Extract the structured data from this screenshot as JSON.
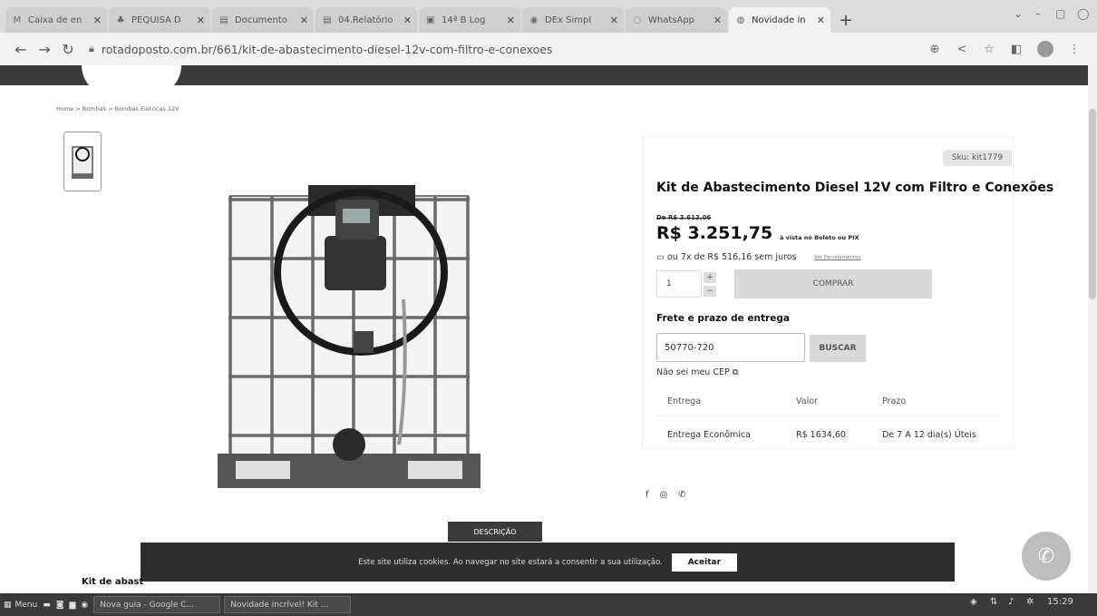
{
  "browser": {
    "tabs": [
      {
        "label": "Caixa de en",
        "icon": "gmail-icon"
      },
      {
        "label": "PEQUISA D",
        "icon": "people-icon"
      },
      {
        "label": "Documento",
        "icon": "doc-icon"
      },
      {
        "label": "04.Relatório",
        "icon": "doc-icon"
      },
      {
        "label": "14ª B Log",
        "icon": "app-icon"
      },
      {
        "label": "DEx Simpl",
        "icon": "globe-icon"
      },
      {
        "label": "WhatsApp",
        "icon": "whatsapp-icon"
      },
      {
        "label": "Novidade in",
        "icon": "site-icon"
      }
    ],
    "new_tab": "+",
    "url": "rotadoposto.com.br/661/kit-de-abastecimento-diesel-12v-com-filtro-e-conexoes"
  },
  "page": {
    "breadcrumb": "Home > Bombas > Bombas Elétricas 12V",
    "sku": "Sku: kit1779",
    "title": "Kit de Abastecimento Diesel 12V com Filtro e Conexões",
    "old_price": "De R$ 3.613,06",
    "price": "R$ 3.251,75",
    "price_note": "à vista no Boleto ou PIX",
    "installments": "ou 7x de R$ 516,16 sem juros",
    "installments_link": "Ver Parcelamentos",
    "quantity": "1",
    "plus": "+",
    "minus": "−",
    "buy_label": "COMPRAR",
    "shipping_title": "Frete e prazo de entrega",
    "cep_value": "50770-720",
    "search_label": "BUSCAR",
    "no_cep": "Não sei meu CEP",
    "ship_table": {
      "headers": [
        "Entrega",
        "Valor",
        "Prazo"
      ],
      "rows": [
        [
          "Entrega Econômica",
          "R$ 1634,60",
          "De 7 A 12 dia(s) Úteis"
        ]
      ]
    },
    "social": [
      "f",
      "◎",
      "✆"
    ],
    "desc_tab": "DESCRIÇÃO",
    "content_heading": "Kit de abast",
    "cookie_text": "Este site utiliza cookies. Ao navegar no site estará a consentir a sua utilização.",
    "cookie_accept": "Aceitar"
  },
  "taskbar": {
    "menu": "Menu",
    "items": [
      "Nova guia - Google C...",
      "Novidade incrível! Kit ..."
    ],
    "clock": "15:29"
  },
  "colors": {
    "header": "#3a3a3a",
    "cookie_bar": "#2e2e2e",
    "whatsapp_button": "#bdbdbd"
  }
}
